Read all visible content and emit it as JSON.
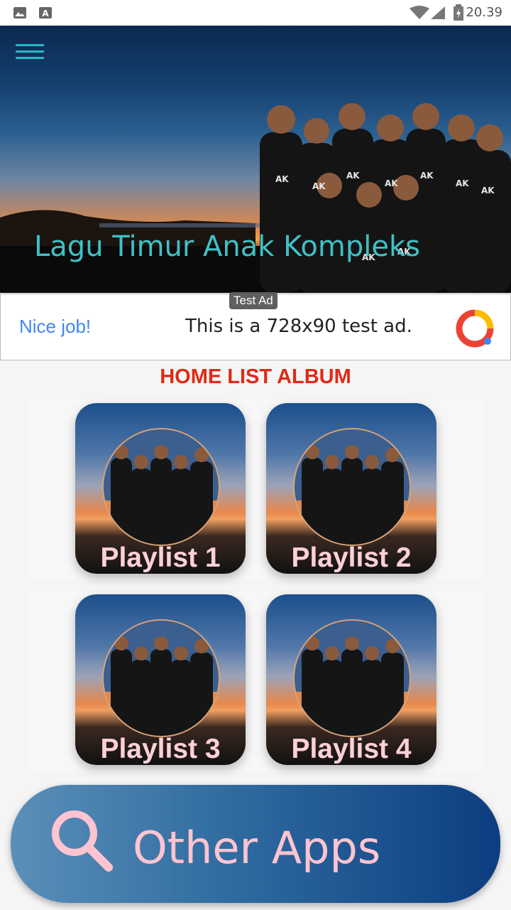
{
  "status_bar": {
    "time": "20.39"
  },
  "header": {
    "title": "Lagu Timur Anak Kompleks"
  },
  "ad": {
    "label": "Test Ad",
    "headline": "Nice job!",
    "body": "This is a 728x90 test ad."
  },
  "section": {
    "title": "HOME LIST ALBUM"
  },
  "playlists": [
    {
      "label": "Playlist 1"
    },
    {
      "label": "Playlist 2"
    },
    {
      "label": "Playlist 3"
    },
    {
      "label": "Playlist 4"
    }
  ],
  "other_apps": {
    "label": "Other Apps"
  },
  "colors": {
    "title_teal": "#3fc1c6",
    "section_red": "#e02a16",
    "playlist_label_pink": "#ffd0d8",
    "button_blue": "#0c3d80"
  }
}
